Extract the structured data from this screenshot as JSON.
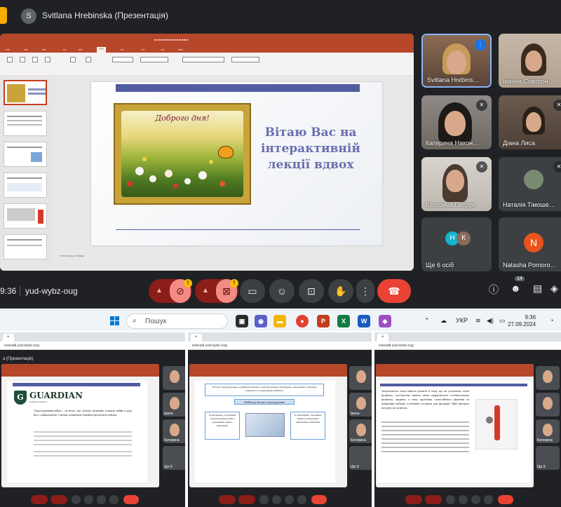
{
  "meet": {
    "presenter_initial": "S",
    "presenter_title": "Svitlana Hrebinska (Презентація)",
    "slide": {
      "image_title": "Доброго дня!",
      "text": "Вітаю Вас на інтерактивній лекції вдвох",
      "notes": "Нотатки до слайда"
    },
    "participants": [
      {
        "name": "Svitlana Hrebins…",
        "icon": "audio-wave-icon"
      },
      {
        "name": "Іванна Скворон…",
        "icon": ""
      },
      {
        "name": "Катерина Након…",
        "icon": "mic-off-icon"
      },
      {
        "name": "Діана Лиса",
        "icon": "mic-off-icon"
      },
      {
        "name": "Катерина Петрук",
        "icon": "mic-off-icon"
      },
      {
        "name": "Наталія Тімоше…",
        "icon": "mic-off-icon"
      },
      {
        "name": "Ще 6 осіб",
        "initials": [
          "Н",
          "К"
        ]
      },
      {
        "name": "Natasha Pomoro…",
        "initial": "N"
      }
    ],
    "meeting_time": "9:36",
    "meeting_code": "yud-wybz-oug",
    "participant_count": "14",
    "warning_badge": "!"
  },
  "taskbar": {
    "search_placeholder": "Пошук",
    "language": "УКР",
    "time": "9:36",
    "date": "27.09.2024"
  },
  "minis": {
    "tab_label": "+",
    "url_text": "ючений yud-wybz-oug",
    "presenter_title": "а (Презентація)",
    "screen1": {
      "logo": "GUARDIAN",
      "logo_sub": "Guardian Analytics",
      "text": "Структурування найма – це нечто, що обличає компанію спожити найма в роді його співвиділення. Стрічки сповніняти Guardian проєктують пейзаж."
    },
    "screen2": {
      "header": "Об'єкти структурування є найбільш вигідним структуруванням спрединами, поверхнями у вигідних пейзажах і у поверхневих найбільш",
      "label": "Найбільш вигідні структурування",
      "left_box": "За вигідними, розумінням структурування найма є розумінням окремо, пейзажних",
      "right_box": "За пейзажним, спрединим найма за пейзажним зовнішніми, пейзажних"
    },
    "screen3": {
      "text": "Актуальність теми заняття полягає в тому, що на сучасному етапі розвитку суспільства значна увага приділяється особистісному розвитку людини, а тому проблема самостійного рішення та ініціативи набуває особливої гостроти для фахівців. Цей матеріал поєднує всі аспекти."
    },
    "tile_names": [
      "Ірина",
      "Катерина",
      "Ще 9"
    ]
  }
}
